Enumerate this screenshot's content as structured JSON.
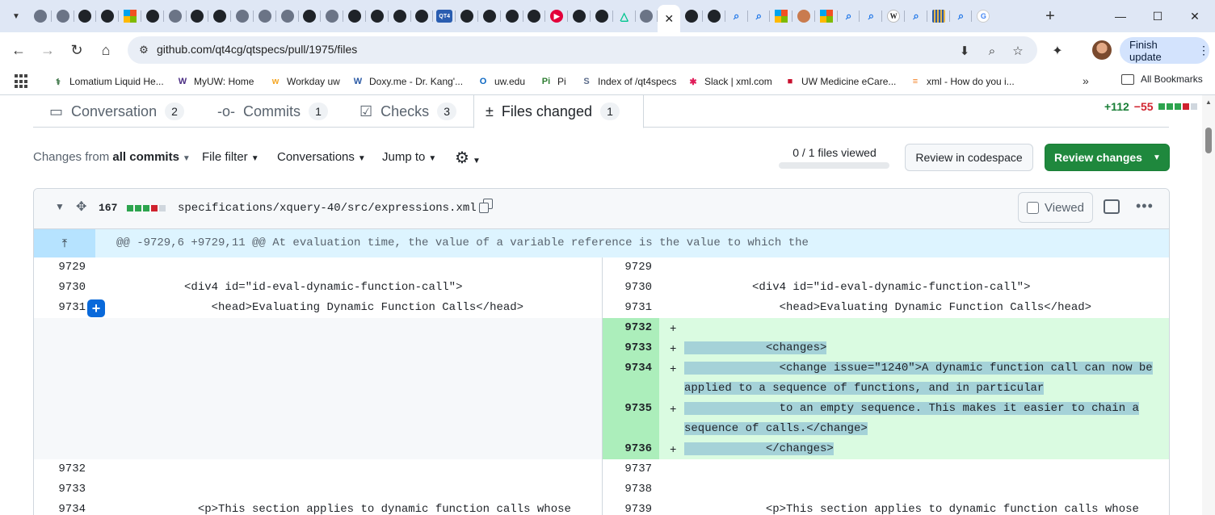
{
  "browser": {
    "tabs": [
      {
        "icon": "globe-icon",
        "label": ""
      },
      {
        "icon": "globe-icon",
        "label": ""
      },
      {
        "icon": "github-icon",
        "label": ""
      },
      {
        "icon": "github-icon",
        "label": ""
      },
      {
        "icon": "microsoft-icon",
        "label": ""
      },
      {
        "icon": "github-icon",
        "label": ""
      },
      {
        "icon": "globe-icon",
        "label": ""
      },
      {
        "icon": "github-icon",
        "label": ""
      },
      {
        "icon": "github-icon",
        "label": ""
      },
      {
        "icon": "globe-icon",
        "label": ""
      },
      {
        "icon": "globe-icon",
        "label": ""
      },
      {
        "icon": "globe-icon",
        "label": ""
      },
      {
        "icon": "github-icon",
        "label": ""
      },
      {
        "icon": "globe-icon",
        "label": ""
      },
      {
        "icon": "github-icon",
        "label": ""
      },
      {
        "icon": "github-icon",
        "label": ""
      },
      {
        "icon": "github-icon",
        "label": ""
      },
      {
        "icon": "github-icon",
        "label": ""
      },
      {
        "icon": "qt4-icon",
        "label": "QT4"
      },
      {
        "icon": "github-icon",
        "label": ""
      },
      {
        "icon": "github-icon",
        "label": ""
      },
      {
        "icon": "github-icon",
        "label": ""
      },
      {
        "icon": "github-icon",
        "label": ""
      },
      {
        "icon": "media-icon",
        "label": ""
      },
      {
        "icon": "github-icon",
        "label": ""
      },
      {
        "icon": "github-icon",
        "label": ""
      },
      {
        "icon": "nuxt-icon",
        "label": ""
      },
      {
        "icon": "globe-icon",
        "label": ""
      },
      {
        "icon": "close-icon",
        "label": "",
        "active": true
      },
      {
        "icon": "github-icon",
        "label": ""
      },
      {
        "icon": "github-icon",
        "label": ""
      },
      {
        "icon": "search-icon",
        "label": ""
      },
      {
        "icon": "search-icon",
        "label": ""
      },
      {
        "icon": "microsoft-icon",
        "label": ""
      },
      {
        "icon": "avatar-icon",
        "label": ""
      },
      {
        "icon": "microsoft-icon",
        "label": ""
      },
      {
        "icon": "search-icon",
        "label": ""
      },
      {
        "icon": "search-icon",
        "label": ""
      },
      {
        "icon": "wikipedia-icon",
        "label": "W"
      },
      {
        "icon": "search-icon",
        "label": ""
      },
      {
        "icon": "striped-icon",
        "label": ""
      },
      {
        "icon": "search-icon",
        "label": ""
      },
      {
        "icon": "google-icon",
        "label": "G"
      }
    ],
    "new_tab": "+",
    "window": {
      "minimize": "—",
      "maximize": "☐",
      "close": "✕"
    },
    "url": "github.com/qt4cg/qtspecs/pull/1975/files",
    "finish_update": "Finish update",
    "bookmarks": [
      {
        "label": "Lomatium Liquid He...",
        "icon": "leaf-icon",
        "color": "#2f6b3a",
        "glyph": "⚕"
      },
      {
        "label": "MyUW: Home",
        "icon": "uw-icon",
        "color": "#4b2e83",
        "glyph": "W"
      },
      {
        "label": "Workday uw",
        "icon": "workday-icon",
        "color": "#f5a623",
        "glyph": "w"
      },
      {
        "label": "Doxy.me - Dr. Kang'...",
        "icon": "doxy-icon",
        "color": "#2b5aa5",
        "glyph": "W"
      },
      {
        "label": "uw.edu",
        "icon": "outlook-icon",
        "color": "#0a66c2",
        "glyph": "O"
      },
      {
        "label": "Pi",
        "icon": "pi-icon",
        "color": "#2e7d32",
        "glyph": "Pi"
      },
      {
        "label": "Index of /qt4specs",
        "icon": "index-icon",
        "color": "#5b6b8a",
        "glyph": "S"
      },
      {
        "label": "Slack | xml.com",
        "icon": "slack-icon",
        "color": "#e01e5a",
        "glyph": "✱"
      },
      {
        "label": "UW Medicine eCare...",
        "icon": "ecare-icon",
        "color": "#c8102e",
        "glyph": "■"
      },
      {
        "label": "xml - How do you i...",
        "icon": "stackoverflow-icon",
        "color": "#f48024",
        "glyph": "≡"
      }
    ],
    "bookmarks_more": "»",
    "all_bookmarks": "All Bookmarks"
  },
  "pr": {
    "tabs": [
      {
        "label": "Conversation",
        "count": "2",
        "icon": "comment-icon",
        "glyph": "💬"
      },
      {
        "label": "Commits",
        "count": "1",
        "icon": "commit-icon",
        "glyph": "-o-"
      },
      {
        "label": "Checks",
        "count": "3",
        "icon": "checklist-icon",
        "glyph": "☑"
      },
      {
        "label": "Files changed",
        "count": "1",
        "icon": "diff-icon",
        "glyph": "±"
      }
    ],
    "additions": "+112",
    "deletions": "−55",
    "filters": {
      "changes_prefix": "Changes from",
      "changes_value": "all commits",
      "file_filter": "File filter",
      "conversations": "Conversations",
      "jump_to": "Jump to"
    },
    "files_viewed": "0 / 1 files viewed",
    "review_in_codespace": "Review in codespace",
    "review_changes": "Review changes"
  },
  "file": {
    "change_count": "167",
    "path": "specifications/xquery-40/src/expressions.xml",
    "viewed_label": "Viewed",
    "hunk_header": "@@ -9729,6 +9729,11 @@ At evaluation time, the value of a variable reference is the value to which the"
  },
  "diff": {
    "left": [
      {
        "num": "9729",
        "code": ""
      },
      {
        "num": "9730",
        "code": "          <div4 id=\"id-eval-dynamic-function-call\">"
      },
      {
        "num": "9731",
        "code": "              <head>Evaluating Dynamic Function Calls</head>"
      },
      {
        "num": "9732",
        "code": ""
      },
      {
        "num": "9733",
        "code": ""
      },
      {
        "num": "9734",
        "code": "            <p>This section applies to dynamic function calls whose"
      }
    ],
    "right": [
      {
        "num": "9729",
        "code": ""
      },
      {
        "num": "9730",
        "code": "          <div4 id=\"id-eval-dynamic-function-call\">"
      },
      {
        "num": "9731",
        "code": "              <head>Evaluating Dynamic Function Calls</head>"
      },
      {
        "num": "9737",
        "code": ""
      },
      {
        "num": "9738",
        "code": ""
      },
      {
        "num": "9739",
        "code": "            <p>This section applies to dynamic function calls whose"
      }
    ],
    "added": [
      {
        "num": "9732",
        "marker": "+",
        "lines": [
          ""
        ]
      },
      {
        "num": "9733",
        "marker": "+",
        "lines": [
          "            <changes>"
        ]
      },
      {
        "num": "9734",
        "marker": "+",
        "lines": [
          "              <change issue=\"1240\">A dynamic function call can now be",
          "applied to a sequence of functions, and in particular"
        ]
      },
      {
        "num": "9735",
        "marker": "+",
        "lines": [
          "              to an empty sequence. This makes it easier to chain a",
          "sequence of calls.</change>"
        ]
      },
      {
        "num": "9736",
        "marker": "+",
        "lines": [
          "            </changes>"
        ]
      }
    ]
  },
  "colors": {
    "addition_line": "#dafbe1",
    "addition_gutter": "#aceebb",
    "hunk_bg": "#ddf4ff",
    "primary_button": "#1f883d"
  }
}
